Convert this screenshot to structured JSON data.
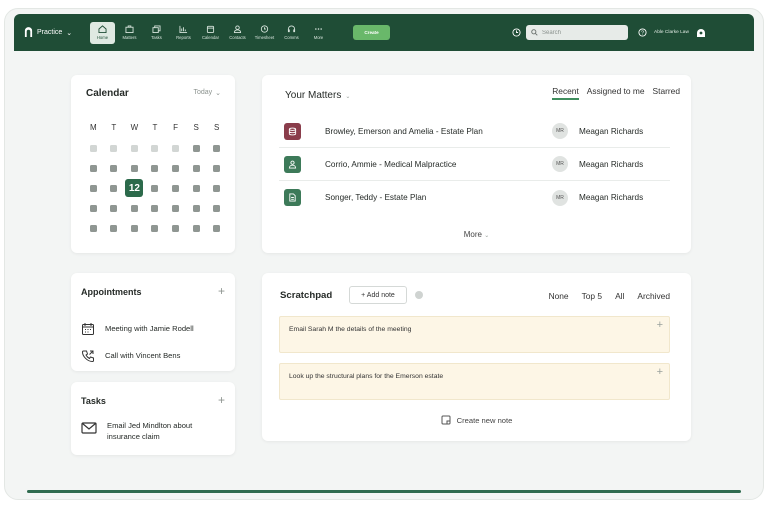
{
  "topbar": {
    "brand": "Practice",
    "brand_caret": "⌄",
    "nav": [
      {
        "label": "Home",
        "icon": "home-icon"
      },
      {
        "label": "Matters",
        "icon": "briefcase-icon"
      },
      {
        "label": "Tasks",
        "icon": "tasks-icon"
      },
      {
        "label": "Reports",
        "icon": "reports-icon"
      },
      {
        "label": "Calendar",
        "icon": "calendar-icon"
      },
      {
        "label": "Contacts",
        "icon": "contacts-icon"
      },
      {
        "label": "Timesheet",
        "icon": "timesheet-icon"
      },
      {
        "label": "Comms",
        "icon": "headset-icon"
      },
      {
        "label": "More",
        "icon": "more-icon"
      }
    ],
    "create_label": "Create",
    "search_placeholder": "Search",
    "firm_name": "Able Clarke Law"
  },
  "calendar": {
    "title": "Calendar",
    "today_label": "Today",
    "weekdays": [
      "M",
      "T",
      "W",
      "T",
      "F",
      "S",
      "S"
    ],
    "today_date": "12"
  },
  "appointments": {
    "title": "Appointments",
    "items": [
      {
        "label": "Meeting with Jamie Rodell",
        "icon": "calendar-event-icon"
      },
      {
        "label": "Call with Vincent Bens",
        "icon": "phone-icon"
      }
    ]
  },
  "tasks": {
    "title": "Tasks",
    "items": [
      {
        "label": "Email Jed Mindlton about insurance claim",
        "icon": "mail-icon"
      }
    ]
  },
  "matters": {
    "title": "Your Matters",
    "tabs": [
      "Recent",
      "Assigned to me",
      "Starred"
    ],
    "rows": [
      {
        "name": "Browley, Emerson and Amelia - Estate Plan",
        "initials": "MR",
        "owner": "Meagan Richards",
        "color": "#8a3d4b"
      },
      {
        "name": "Corrio, Ammie - Medical Malpractice",
        "initials": "MR",
        "owner": "Meagan Richards",
        "color": "#3d7a59"
      },
      {
        "name": "Songer, Teddy - Estate Plan",
        "initials": "MR",
        "owner": "Meagan Richards",
        "color": "#3d7a59"
      }
    ],
    "more_label": "More"
  },
  "scratchpad": {
    "title": "Scratchpad",
    "add_note_label": "+ Add note",
    "filters": [
      "None",
      "Top 5",
      "All",
      "Archived"
    ],
    "notes": [
      "Email Sarah M the details of the meeting",
      "Look up the structural plans for the Emerson estate"
    ],
    "create_label": "Create new note"
  },
  "colors": {
    "brand_green": "#1f4d36",
    "accent_green": "#69b86a",
    "note_bg": "#fdf6e6"
  }
}
